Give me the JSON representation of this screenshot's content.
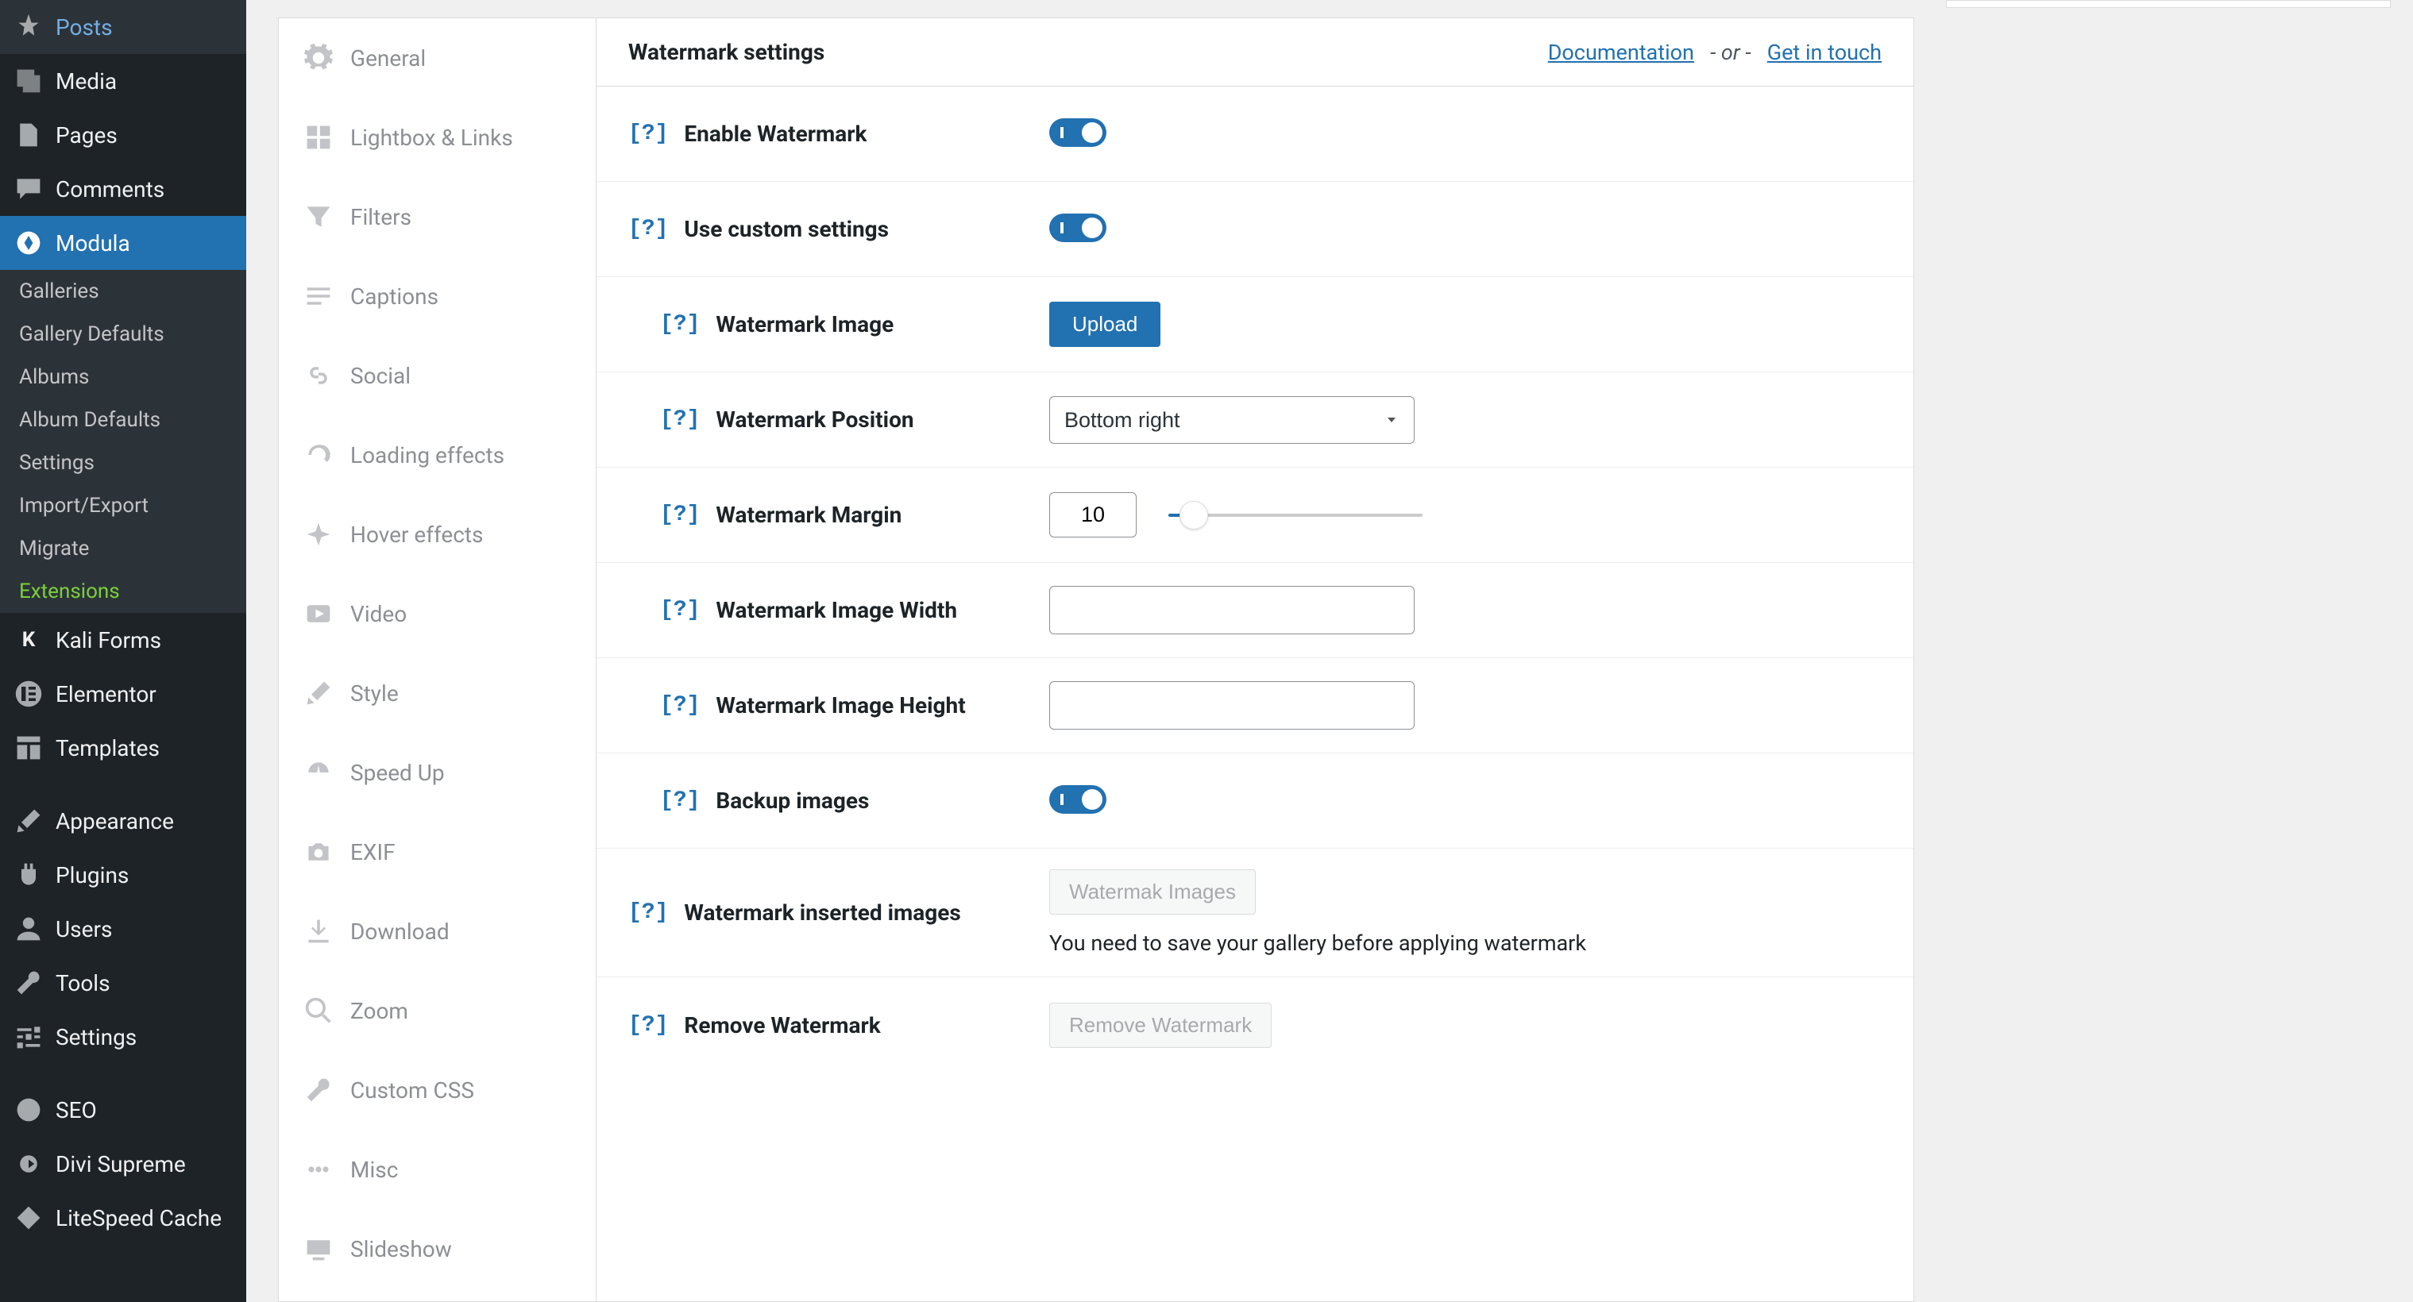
{
  "adminMenu": {
    "posts": "Posts",
    "media": "Media",
    "pages": "Pages",
    "comments": "Comments",
    "modula": "Modula",
    "kaliForms": "Kali Forms",
    "elementor": "Elementor",
    "templates": "Templates",
    "appearance": "Appearance",
    "plugins": "Plugins",
    "users": "Users",
    "tools": "Tools",
    "settings": "Settings",
    "seo": "SEO",
    "divi": "Divi Supreme",
    "litespeed": "LiteSpeed Cache"
  },
  "modulaSub": {
    "galleries": "Galleries",
    "galleryDefaults": "Gallery Defaults",
    "albums": "Albums",
    "albumDefaults": "Album Defaults",
    "settings": "Settings",
    "importExport": "Import/Export",
    "migrate": "Migrate",
    "extensions": "Extensions"
  },
  "tabs": {
    "general": "General",
    "lightbox": "Lightbox & Links",
    "filters": "Filters",
    "captions": "Captions",
    "social": "Social",
    "loading": "Loading effects",
    "hover": "Hover effects",
    "video": "Video",
    "style": "Style",
    "speedup": "Speed Up",
    "exif": "EXIF",
    "download": "Download",
    "zoom": "Zoom",
    "customcss": "Custom CSS",
    "misc": "Misc",
    "slideshow": "Slideshow"
  },
  "header": {
    "title": "Watermark settings",
    "docLink": "Documentation",
    "or": "- or -",
    "touchLink": "Get in touch"
  },
  "help": "[?]",
  "fields": {
    "enable": "Enable Watermark",
    "custom": "Use custom settings",
    "image": "Watermark Image",
    "position": "Watermark Position",
    "margin": "Watermark Margin",
    "width": "Watermark Image Width",
    "height": "Watermark Image Height",
    "backup": "Backup images",
    "inserted": "Watermark inserted images",
    "remove": "Remove Watermark"
  },
  "controls": {
    "uploadBtn": "Upload",
    "positionValue": "Bottom right",
    "marginValue": "10",
    "watermarkImagesBtn": "Watermak Images",
    "saveNote": "You need to save your gallery before applying watermark",
    "removeBtn": "Remove Watermark"
  }
}
